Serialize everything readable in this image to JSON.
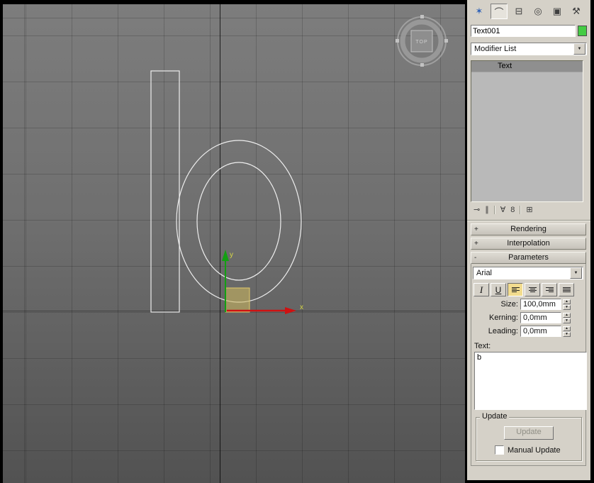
{
  "viewport": {
    "view_label": "TOP",
    "x_axis_label": "x",
    "y_axis_label": "y",
    "gizmo_colors": {
      "x_axis": "#cf1111",
      "y_axis": "#12a012",
      "plane_fill": "rgba(209,188,94,0.55)",
      "plane_stroke": "#e2cb6b",
      "label": "#d8d845"
    },
    "shape_outline_color": "#eeeeee"
  },
  "panel": {
    "tabs": [
      {
        "name": "create",
        "glyph": "✶"
      },
      {
        "name": "modify",
        "glyph": "⌒"
      },
      {
        "name": "hierarchy",
        "glyph": "⊟"
      },
      {
        "name": "motion",
        "glyph": "◎"
      },
      {
        "name": "display",
        "glyph": "▣"
      },
      {
        "name": "utilities",
        "glyph": "⚒"
      }
    ],
    "object_name": "Text001",
    "object_color": "#44cc44",
    "modifier_list_label": "Modifier List",
    "stack": [
      {
        "label": "Text",
        "selected": true
      }
    ],
    "stack_tools": [
      {
        "name": "pin-stack",
        "glyph": "⊸"
      },
      {
        "name": "show-end-result",
        "glyph": "∥"
      },
      {
        "name": "make-unique",
        "glyph": "∀"
      },
      {
        "name": "remove-modifier",
        "glyph": "8"
      },
      {
        "name": "configure-modifier-sets",
        "glyph": "⊞"
      }
    ],
    "icons": {
      "dropdown_arrow": "▼",
      "spinner_up": "▲",
      "spinner_down": "▼"
    },
    "rollouts": [
      {
        "label": "Rendering",
        "state": "+"
      },
      {
        "label": "Interpolation",
        "state": "+"
      },
      {
        "label": "Parameters",
        "state": "-"
      }
    ],
    "parameters": {
      "font": "Arial",
      "italic_glyph": "I",
      "underline_glyph": "U",
      "size_label": "Size:",
      "size_value": "100,0mm",
      "kerning_label": "Kerning:",
      "kerning_value": "0,0mm",
      "leading_label": "Leading:",
      "leading_value": "0,0mm",
      "text_label": "Text:",
      "text_value": "b",
      "update": {
        "group_label": "Update",
        "button_label": "Update",
        "manual_label": "Manual Update",
        "manual_checked": false
      }
    }
  }
}
